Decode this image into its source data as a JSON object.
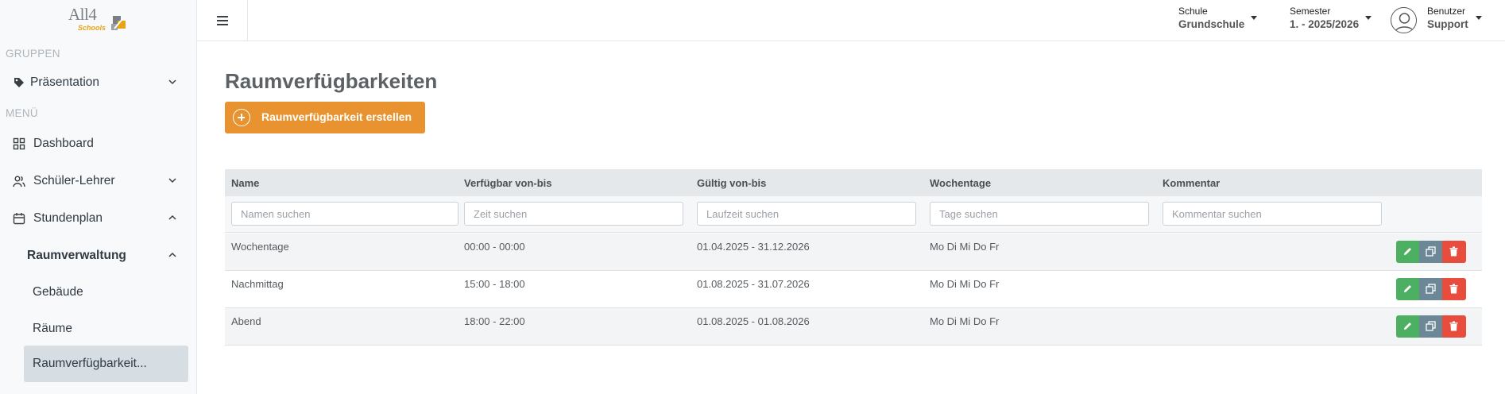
{
  "app": {
    "logo_text": "All4",
    "logo_sub": "Schools"
  },
  "header": {
    "school": {
      "label": "Schule",
      "value": "Grundschule"
    },
    "semester": {
      "label": "Semester",
      "value": "1. - 2025/2026"
    },
    "user": {
      "label": "Benutzer",
      "value": "Support"
    }
  },
  "sidebar": {
    "section_groups": "GRUPPEN",
    "section_menu": "MENÜ",
    "items": [
      {
        "label": "Präsentation",
        "icon": "tag-icon"
      },
      {
        "label": "Dashboard",
        "icon": "grid-icon"
      },
      {
        "label": "Schüler-Lehrer",
        "icon": "users-icon"
      },
      {
        "label": "Stundenplan",
        "icon": "calendar-icon"
      },
      {
        "label": "Raumverwaltung"
      },
      {
        "label": "Gebäude"
      },
      {
        "label": "Räume"
      },
      {
        "label": "Raumverfügbarkeit..."
      }
    ]
  },
  "main": {
    "title": "Raumverfügbarkeiten",
    "create_button": "Raumverfügbarkeit erstellen",
    "table": {
      "columns": [
        "Name",
        "Verfügbar von-bis",
        "Gültig von-bis",
        "Wochentage",
        "Kommentar"
      ],
      "filters": [
        "Namen suchen",
        "Zeit suchen",
        "Laufzeit suchen",
        "Tage suchen",
        "Kommentar suchen"
      ],
      "rows": [
        {
          "name": "Wochentage",
          "time": "00:00 - 00:00",
          "valid": "01.04.2025 - 31.12.2026",
          "days": "Mo Di Mi Do Fr",
          "comment": ""
        },
        {
          "name": "Nachmittag",
          "time": "15:00 - 18:00",
          "valid": "01.08.2025 - 31.07.2026",
          "days": "Mo Di Mi Do Fr",
          "comment": ""
        },
        {
          "name": "Abend",
          "time": "18:00 - 22:00",
          "valid": "01.08.2025 - 01.08.2026",
          "days": "Mo Di Mi Do Fr",
          "comment": ""
        }
      ]
    }
  },
  "colors": {
    "accent": "#e8932f",
    "edit": "#4caf62",
    "copy": "#6c8795",
    "delete": "#e74c3c",
    "logo_gold": "#e8a317"
  }
}
